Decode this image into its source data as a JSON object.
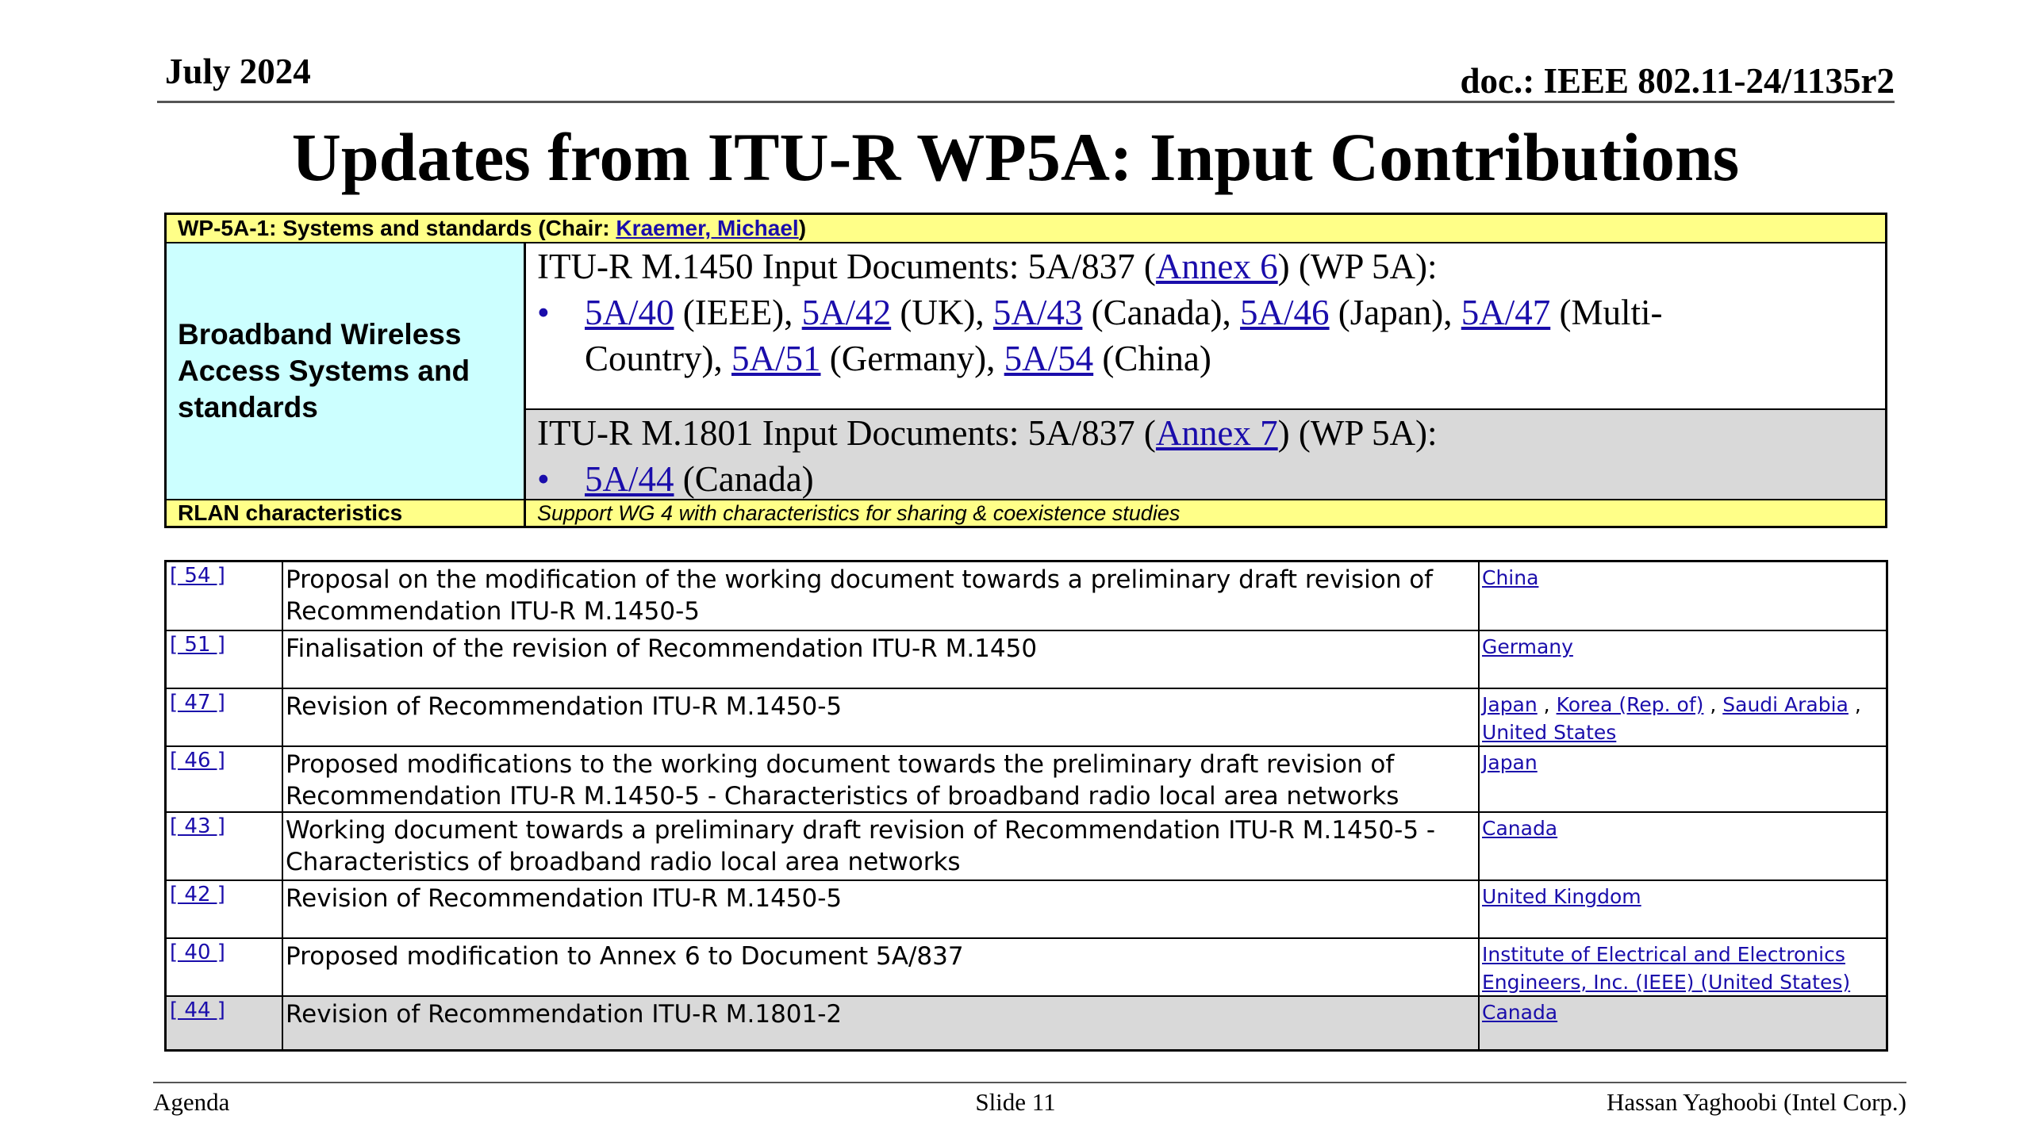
{
  "header": {
    "date": "July 2024",
    "doc": "doc.: IEEE 802.11-24/1135r2"
  },
  "title": "Updates from ITU-R WP5A: Input Contributions",
  "top_table": {
    "head_prefix": "WP-5A-1: Systems and standards (Chair: ",
    "head_chair": "Kraemer, Michael",
    "head_suffix": ")",
    "bw_label": "Broadband Wireless Access Systems and standards",
    "m1450": {
      "prefix": "ITU-R M.1450 Input Documents: 5A/837 (",
      "annex": "Annex 6",
      "suffix": ") (WP 5A):",
      "bullet": "•",
      "items": [
        {
          "doc": "5A/40",
          "src": " (IEEE), "
        },
        {
          "doc": "5A/42",
          "src": " (UK), "
        },
        {
          "doc": "5A/43",
          "src": " (Canada), "
        },
        {
          "doc": "5A/46",
          "src": " (Japan), "
        },
        {
          "doc": "5A/47",
          "src": " (Multi-"
        }
      ],
      "line2_prefix": "Country), ",
      "items2": [
        {
          "doc": "5A/51",
          "src": " (Germany), "
        },
        {
          "doc": "5A/54",
          "src": " (China)"
        }
      ]
    },
    "m1801": {
      "prefix": "ITU-R M.1801 Input Documents: 5A/837 (",
      "annex": "Annex 7",
      "suffix": ") (WP 5A):",
      "bullet": "•",
      "doc": "5A/44",
      "src": " (Canada)"
    },
    "rlan_label": "RLAN characteristics",
    "rlan_value": "Support WG 4 with characteristics for sharing & coexistence studies"
  },
  "contributions": [
    {
      "num": "[ 54 ]",
      "title": "Proposal on the modification of the working document towards a preliminary draft revision of Recommendation ITU-R M.1450-5",
      "sources": [
        "China"
      ]
    },
    {
      "num": "[ 51 ]",
      "title": "Finalisation of the revision of Recommendation ITU-R M.1450",
      "sources": [
        "Germany"
      ]
    },
    {
      "num": "[ 47 ]",
      "title": "Revision of Recommendation ITU-R M.1450-5",
      "sources": [
        "Japan",
        "Korea (Rep. of)",
        "Saudi Arabia",
        "United States"
      ]
    },
    {
      "num": "[ 46 ]",
      "title": "Proposed modifications to the working document towards the preliminary draft revision of Recommendation ITU-R M.1450-5 - Characteristics of broadband radio local area networks",
      "sources": [
        "Japan"
      ]
    },
    {
      "num": "[ 43 ]",
      "title": "Working document towards a preliminary draft revision of Recommendation ITU-R M.1450-5 - Characteristics of broadband radio local area networks",
      "sources": [
        "Canada"
      ]
    },
    {
      "num": "[ 42 ]",
      "title": "Revision of Recommendation ITU-R M.1450-5",
      "sources": [
        "United Kingdom"
      ]
    },
    {
      "num": "[ 40 ]",
      "title": "Proposed modification to Annex 6 to Document 5A/837",
      "sources": [
        "Institute of Electrical and Electronics Engineers, Inc. (IEEE) (United States)"
      ]
    },
    {
      "num": "[ 44 ]",
      "title": "Revision of Recommendation ITU-R M.1801-2",
      "sources": [
        "Canada"
      ]
    }
  ],
  "footer": {
    "left": "Agenda",
    "center": "Slide 11",
    "right": "Hassan Yaghoobi (Intel Corp.)"
  }
}
